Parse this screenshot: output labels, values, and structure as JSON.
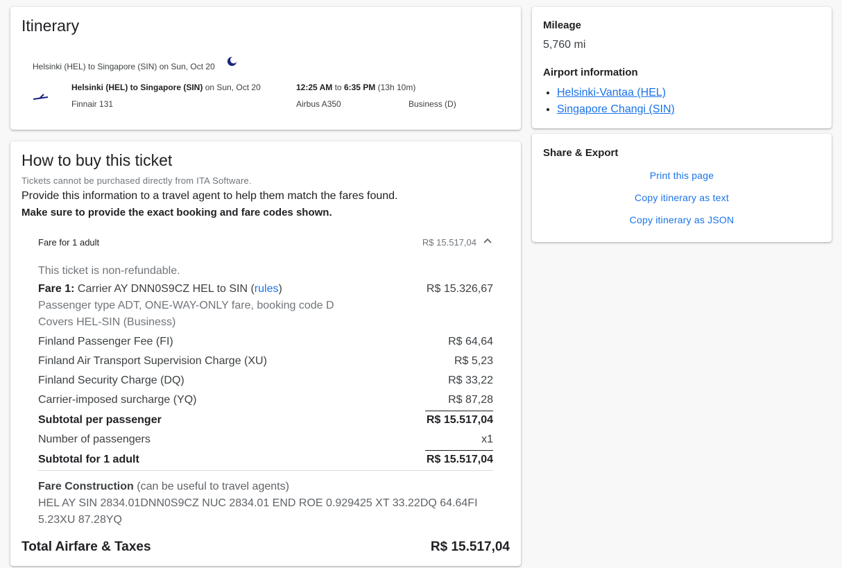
{
  "itinerary": {
    "title": "Itinerary",
    "summary": "Helsinki (HEL) to Singapore (SIN) on Sun, Oct 20",
    "segment": {
      "route_bold": "Helsinki (HEL) to Singapore (SIN)",
      "route_date": " on Sun, Oct 20",
      "time_bold": "12:25 AM",
      "time_to": " to ",
      "time_arr_bold": "6:35 PM",
      "duration": " (13h 10m)",
      "flight": "Finnair 131",
      "aircraft": "Airbus A350",
      "cabin": "Business (D)"
    },
    "icons": {
      "overnight": "moon-icon",
      "airline": "finnair-logo"
    }
  },
  "buy": {
    "title": "How to buy this ticket",
    "note": "Tickets cannot be purchased directly from ITA Software.",
    "provide": "Provide this information to a travel agent to help them match the fares found.",
    "exact": "Make sure to provide the exact booking and fare codes shown.",
    "fare_header": {
      "label": "Fare for 1 adult",
      "amount": "R$ 15.517,04",
      "icon": "chevron-up-icon"
    },
    "non_refundable": "This ticket is non-refundable.",
    "fare1": {
      "label_bold": "Fare 1:",
      "label": " Carrier AY DNN0S9CZ HEL to SIN (",
      "link": "rules",
      "label_end": ")",
      "amount": "R$ 15.326,67",
      "detail1": "Passenger type ADT, ONE-WAY-ONLY fare, booking code D",
      "detail2": "Covers HEL-SIN (Business)"
    },
    "taxes": [
      {
        "label": "Finland Passenger Fee (FI)",
        "amount": "R$ 64,64"
      },
      {
        "label": "Finland Air Transport Supervision Charge (XU)",
        "amount": "R$ 5,23"
      },
      {
        "label": "Finland Security Charge (DQ)",
        "amount": "R$ 33,22"
      },
      {
        "label": "Carrier-imposed surcharge (YQ)",
        "amount": "R$ 87,28"
      }
    ],
    "subtotal_per_passenger": {
      "label": "Subtotal per passenger",
      "amount": "R$ 15.517,04"
    },
    "num_passengers": {
      "label": "Number of passengers",
      "amount": "x1"
    },
    "subtotal_adult": {
      "label": "Subtotal for 1 adult",
      "amount": "R$ 15.517,04"
    },
    "fare_construction": {
      "label_bold": "Fare Construction",
      "label": " (can be useful to travel agents)",
      "line1": "HEL AY SIN 2834.01DNN0S9CZ NUC 2834.01 END ROE 0.929425 XT 33.22DQ 64.64FI",
      "line2": "5.23XU 87.28YQ"
    },
    "total": {
      "label": "Total Airfare & Taxes",
      "amount": "R$ 15.517,04"
    }
  },
  "mileage": {
    "heading": "Mileage",
    "value": "5,760 mi",
    "airport_heading": "Airport information",
    "airports": [
      "Helsinki-Vantaa (HEL)",
      "Singapore Changi (SIN)"
    ]
  },
  "share": {
    "heading": "Share & Export",
    "actions": [
      "Print this page",
      "Copy itinerary as text",
      "Copy itinerary as JSON"
    ]
  },
  "colors": {
    "link": "#1a73e8",
    "background": "#f8f8f8",
    "logo": "#1a237e"
  }
}
